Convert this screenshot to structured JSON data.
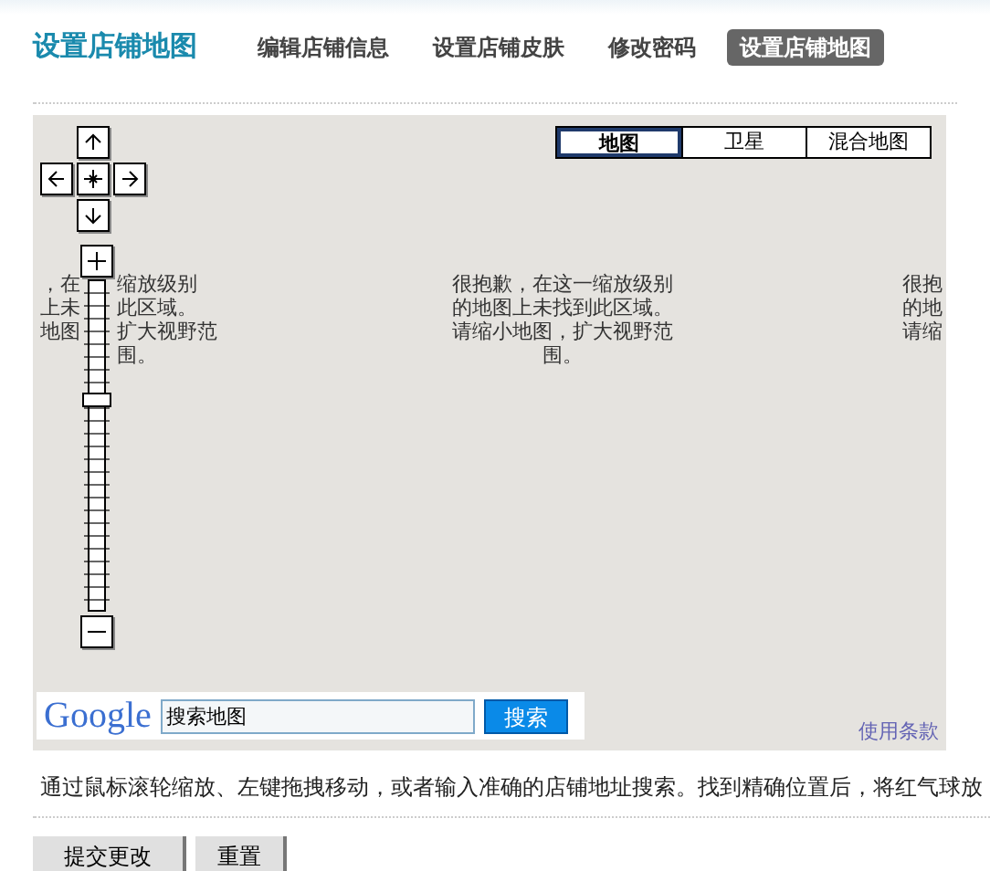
{
  "header": {
    "title": "设置店铺地图",
    "nav": [
      {
        "label": "编辑店铺信息",
        "selected": false
      },
      {
        "label": "设置店铺皮肤",
        "selected": false
      },
      {
        "label": "修改密码",
        "selected": false
      },
      {
        "label": "设置店铺地图",
        "selected": true
      }
    ]
  },
  "map": {
    "map_types": [
      {
        "label": "地图",
        "selected": true
      },
      {
        "label": "卫星",
        "selected": false
      },
      {
        "label": "混合地图",
        "selected": false
      }
    ],
    "left_tile": {
      "rows": [
        {
          "before": "，在",
          "after": "缩放级别"
        },
        {
          "before": "上未",
          "after": "此区域。"
        },
        {
          "before": "地图",
          "after": "扩大视野范"
        },
        {
          "after": "围。"
        }
      ]
    },
    "tiles": [
      {
        "lines": [
          "很抱歉，在这一缩放级别",
          "的地图上未找到此区域。",
          "请缩小地图，扩大视野范",
          "围。"
        ]
      },
      {
        "lines": [
          "很抱",
          "的地",
          "请缩"
        ]
      }
    ],
    "zoom": {
      "level": 0.66
    },
    "search": {
      "logo": "Google",
      "value": "搜索地图",
      "button": "搜索"
    },
    "terms_link": "使用条款"
  },
  "instructions": "通过鼠标滚轮缩放、左键拖拽移动，或者输入准确的店铺地址搜索。找到精确位置后，将红气球放",
  "buttons": [
    "提交更改",
    "重置"
  ]
}
